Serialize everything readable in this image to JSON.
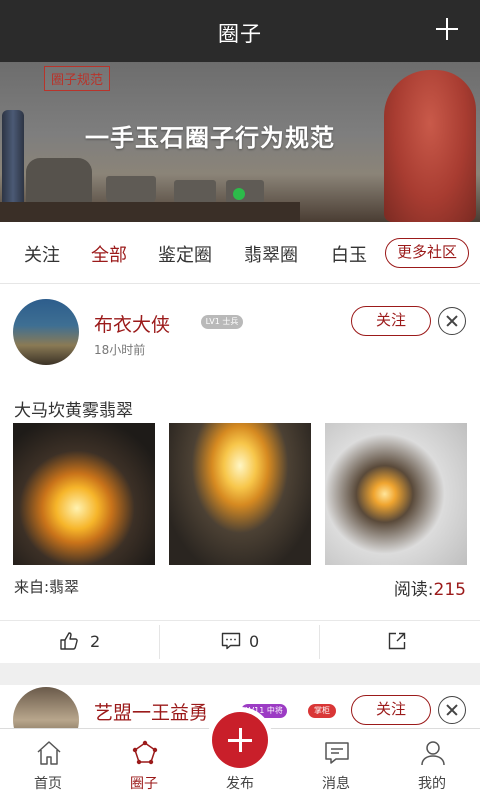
{
  "header": {
    "title": "圈子",
    "add_icon": "plus-icon"
  },
  "banner": {
    "stamp": "圈子规范",
    "headline": "一手玉石圈子行为规范"
  },
  "tabs": [
    {
      "label": "关注",
      "active": false
    },
    {
      "label": "全部",
      "active": true
    },
    {
      "label": "鉴定圈",
      "active": false
    },
    {
      "label": "翡翠圈",
      "active": false
    },
    {
      "label": "白玉",
      "active": false
    }
  ],
  "more_tabs_label": "更多社区",
  "posts": [
    {
      "username": "布衣大侠",
      "badge": "LV1 士兵",
      "time": "18小时前",
      "follow_label": "关注",
      "title": "大马坎黄雾翡翠",
      "source": "来自:翡翠",
      "reads_label": "阅读:",
      "reads_value": "215",
      "likes": "2",
      "comments": "0"
    },
    {
      "username": "艺盟一王益勇",
      "badge": "LV11 中将",
      "role_badge": "掌柜",
      "follow_label": "关注"
    }
  ],
  "nav": [
    {
      "label": "首页",
      "icon": "home-icon",
      "active": false
    },
    {
      "label": "圈子",
      "icon": "circle-icon",
      "active": true
    },
    {
      "label": "发布",
      "icon": "publish-icon",
      "active": false
    },
    {
      "label": "消息",
      "icon": "message-icon",
      "active": false
    },
    {
      "label": "我的",
      "icon": "profile-icon",
      "active": false
    }
  ],
  "colors": {
    "accent": "#9b1a1a",
    "publish": "#c91f2a",
    "header_bg": "#2b2b2b"
  }
}
